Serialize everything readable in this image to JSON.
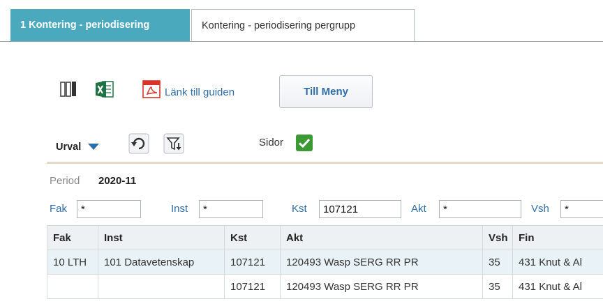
{
  "tabs": [
    {
      "label": "1 Kontering - periodisering",
      "active": true
    },
    {
      "label": "Kontering - periodisering pergrupp",
      "active": false
    }
  ],
  "toolbar": {
    "columns_icon": "columns-icon",
    "excel_icon": "excel-icon",
    "pdf_icon": "pdf-icon",
    "link_label": "Länk till guiden",
    "menu_button": "Till Meny"
  },
  "filterbar": {
    "urval_label": "Urval",
    "refresh_icon": "refresh-icon",
    "filter_icon": "filter-down-icon",
    "sidor_label": "Sidor",
    "sidor_checked": true
  },
  "period": {
    "label": "Period",
    "value": "2020-11"
  },
  "filters": [
    {
      "label": "Fak",
      "value": "*"
    },
    {
      "label": "Inst",
      "value": "*"
    },
    {
      "label": "Kst",
      "value": "107121"
    },
    {
      "label": "Akt",
      "value": "*"
    },
    {
      "label": "Vsh",
      "value": "*"
    }
  ],
  "table": {
    "columns": [
      "Fak",
      "Inst",
      "Kst",
      "Akt",
      "Vsh",
      "Fin"
    ],
    "rows": [
      [
        "10 LTH",
        "101 Datavetenskap",
        "107121",
        "120493 Wasp SERG RR PR",
        "35",
        "431 Knut & Al"
      ],
      [
        "",
        "",
        "107121",
        "120493 Wasp SERG RR PR",
        "35",
        "431 Knut & Al"
      ]
    ]
  },
  "colors": {
    "accent": "#4aa9bd",
    "link": "#2f6da8",
    "check": "#3c9a35",
    "excel": "#1e7145",
    "pdf": "#d9322a"
  }
}
